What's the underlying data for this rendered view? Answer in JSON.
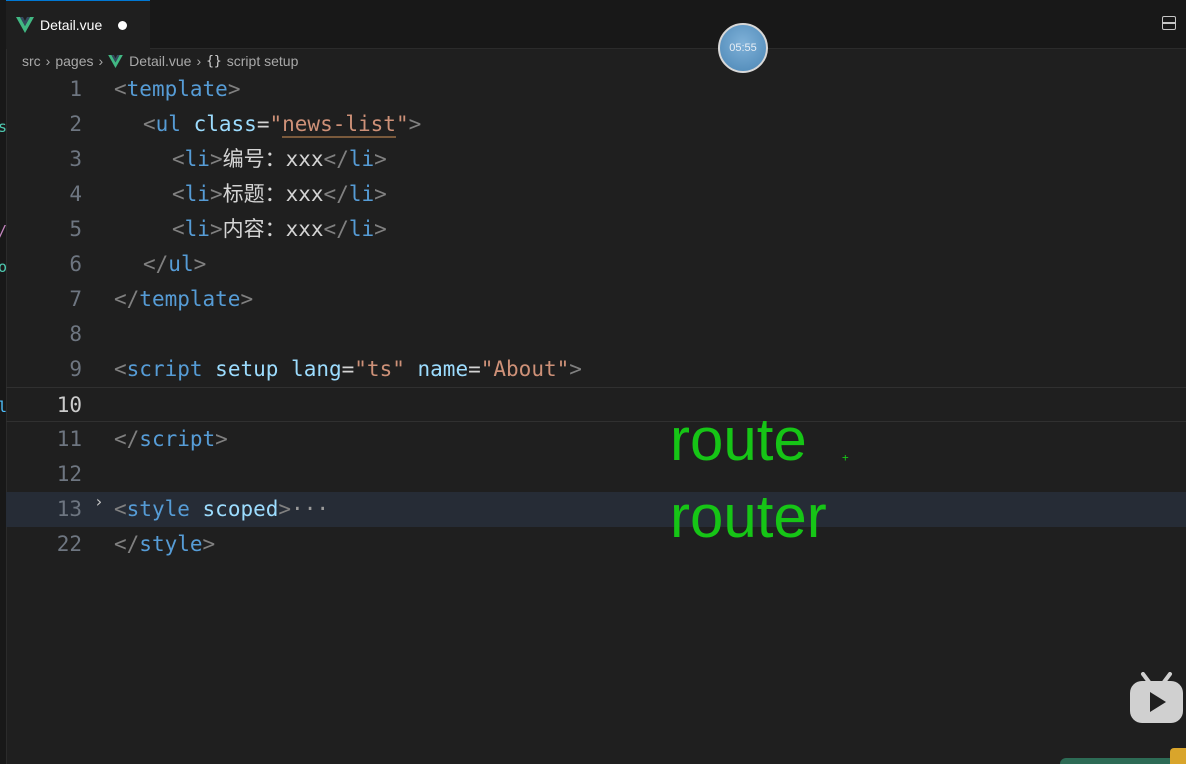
{
  "tab": {
    "file_name": "Detail.vue"
  },
  "breadcrumb": {
    "parts": [
      "src",
      "pages",
      "Detail.vue",
      "script setup"
    ],
    "braces": "{}"
  },
  "timer": {
    "time": "05:55"
  },
  "editor": {
    "current_line": "10",
    "lines": [
      {
        "num": "1",
        "t1": "<",
        "tag": "template",
        "t2": ">"
      },
      {
        "num": "2",
        "t1": "<",
        "tag": "ul",
        "attr": "class",
        "eq": "=",
        "q1": "\"",
        "val": "news-list",
        "q2": "\"",
        "t2": ">"
      },
      {
        "num": "3",
        "t1": "<",
        "tag": "li",
        "t2": ">",
        "text": "编号：xxx",
        "t3": "</",
        "tag2": "li",
        "t4": ">"
      },
      {
        "num": "4",
        "t1": "<",
        "tag": "li",
        "t2": ">",
        "text": "标题：xxx",
        "t3": "</",
        "tag2": "li",
        "t4": ">"
      },
      {
        "num": "5",
        "t1": "<",
        "tag": "li",
        "t2": ">",
        "text": "内容：xxx",
        "t3": "</",
        "tag2": "li",
        "t4": ">"
      },
      {
        "num": "6",
        "t1": "</",
        "tag": "ul",
        "t2": ">"
      },
      {
        "num": "7",
        "t1": "</",
        "tag": "template",
        "t2": ">"
      },
      {
        "num": "8"
      },
      {
        "num": "9",
        "t1": "<",
        "tag": "script",
        "a1": "setup",
        "a2": "lang",
        "eq": "=",
        "v2": "\"ts\"",
        "a3": "name",
        "v3": "\"About\"",
        "t2": ">"
      },
      {
        "num": "10"
      },
      {
        "num": "11",
        "t1": "</",
        "tag": "script",
        "t2": ">"
      },
      {
        "num": "12"
      },
      {
        "num": "13",
        "t1": "<",
        "tag": "style",
        "a1": "scoped",
        "t2": ">",
        "ellipsis": "···"
      },
      {
        "num": "22",
        "t1": "</",
        "tag": "style",
        "t2": ">"
      }
    ]
  },
  "overlay": {
    "word1": "route",
    "word2": "router",
    "plus": "+"
  },
  "colors": {
    "overlay_green": "#16c516",
    "tag_blue": "#569cd6",
    "attr_lightblue": "#9cdcfe",
    "string_orange": "#ce9178"
  }
}
